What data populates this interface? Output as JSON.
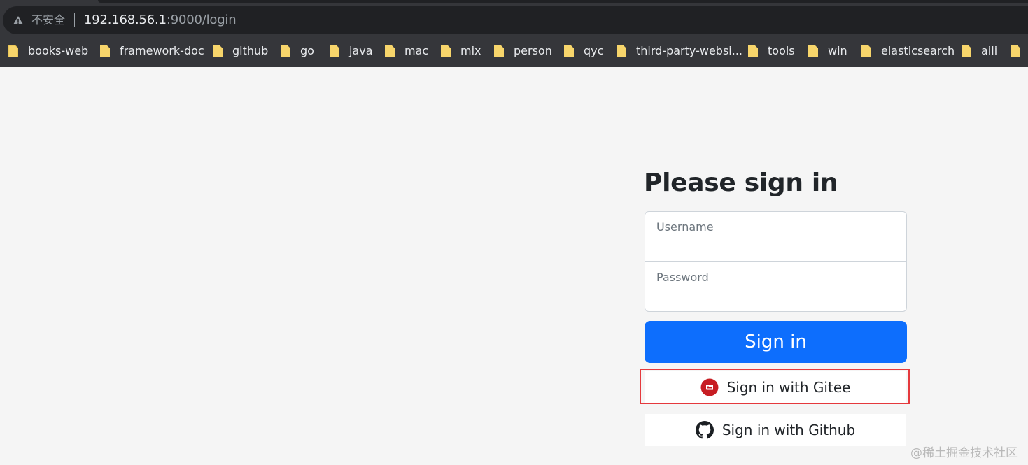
{
  "browser": {
    "security_label": "不安全",
    "url_host": "192.168.56.1",
    "url_path": ":9000/login"
  },
  "bookmarks": [
    {
      "label": "books-web",
      "icon": "folder-icon"
    },
    {
      "label": "framework-doc",
      "icon": "folder-icon"
    },
    {
      "label": "github",
      "icon": "folder-icon"
    },
    {
      "label": "go",
      "icon": "folder-icon"
    },
    {
      "label": "java",
      "icon": "folder-icon"
    },
    {
      "label": "mac",
      "icon": "folder-icon"
    },
    {
      "label": "mix",
      "icon": "folder-icon"
    },
    {
      "label": "person",
      "icon": "folder-icon"
    },
    {
      "label": "qyc",
      "icon": "folder-icon"
    },
    {
      "label": "third-party-websi...",
      "icon": "folder-icon"
    },
    {
      "label": "tools",
      "icon": "folder-icon"
    },
    {
      "label": "win",
      "icon": "folder-icon"
    },
    {
      "label": "elasticsearch",
      "icon": "folder-icon"
    },
    {
      "label": "aili",
      "icon": "folder-icon"
    },
    {
      "label": "",
      "icon": "folder-icon"
    }
  ],
  "login": {
    "heading": "Please sign in",
    "username_placeholder": "Username",
    "password_placeholder": "Password",
    "signin_label": "Sign in",
    "gitee_label": "Sign in with Gitee",
    "github_label": "Sign in with Github"
  },
  "watermark": "@稀土掘金技术社区",
  "colors": {
    "primary": "#0d6efd",
    "highlight": "#e5393d",
    "gitee": "#c71d23"
  }
}
